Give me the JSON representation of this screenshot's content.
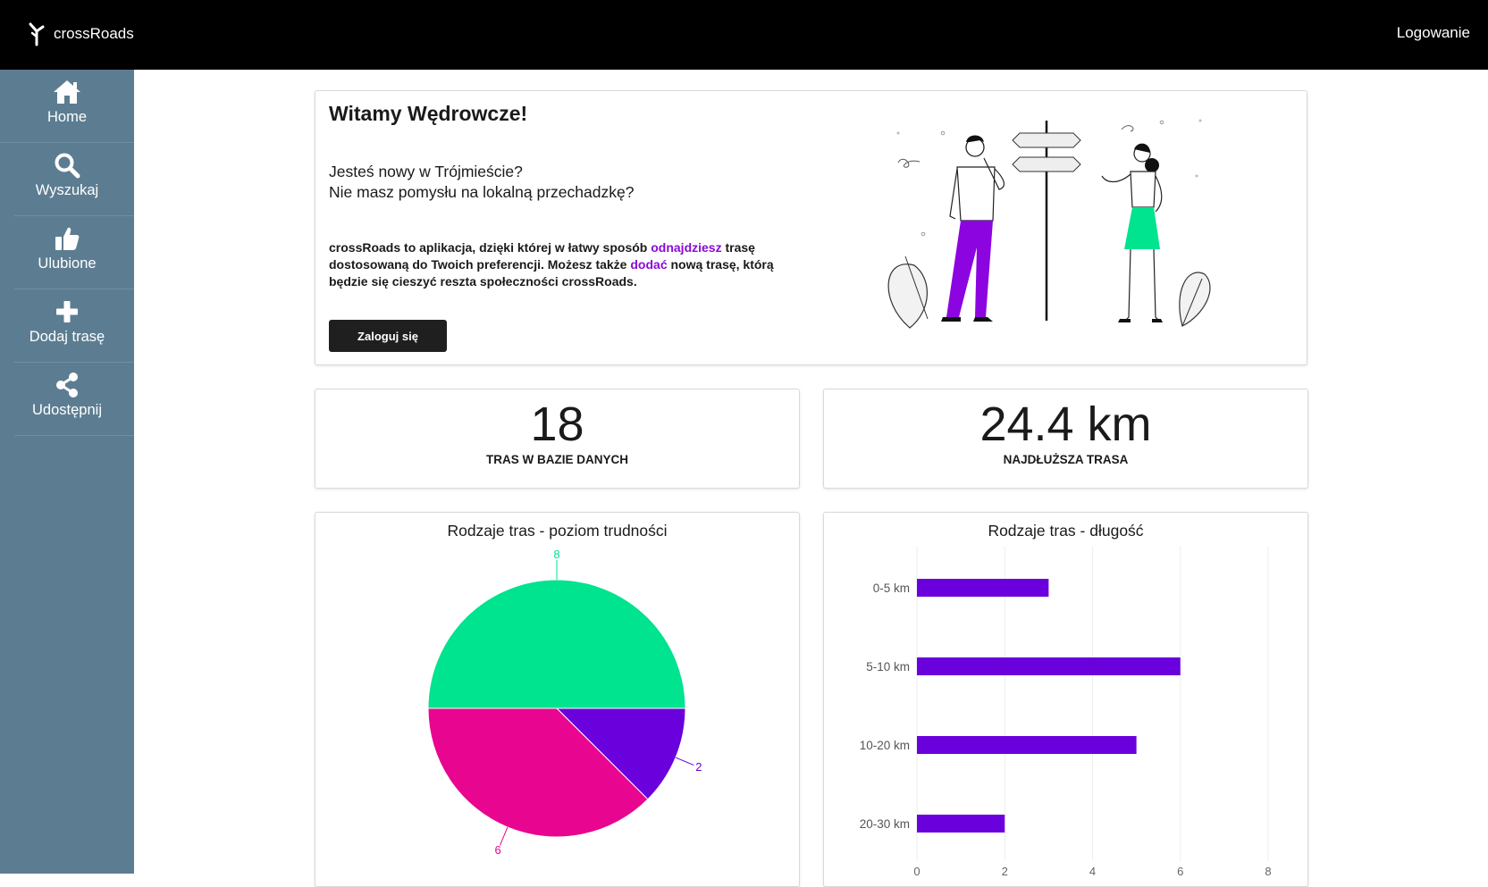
{
  "app": {
    "brand": "crossRoads",
    "login_link": "Logowanie"
  },
  "sidebar": {
    "items": [
      {
        "label": "Home",
        "icon": "home-icon"
      },
      {
        "label": "Wyszukaj",
        "icon": "search-icon"
      },
      {
        "label": "Ulubione",
        "icon": "thumbs-up-icon"
      },
      {
        "label": "Dodaj trasę",
        "icon": "plus-icon"
      },
      {
        "label": "Udostępnij",
        "icon": "share-icon"
      }
    ]
  },
  "welcome": {
    "title": "Witamy Wędrowcze!",
    "question1": "Jesteś nowy w Trójmieście?",
    "question2": "Nie masz pomysłu na lokalną przechadzkę?",
    "desc_part1": "crossRoads to aplikacja, dzięki której w łatwy sposób ",
    "desc_hl1": "odnajdziesz",
    "desc_part2": " trasę dostosowaną do Twoich preferencji. Możesz także ",
    "desc_hl2": "dodać",
    "desc_part3": " nową trasę, którą będzie się cieszyć reszta społeczności crossRoads.",
    "button": "Zaloguj się"
  },
  "stats": [
    {
      "value": "18",
      "caption": "TRAS W BAZIE DANYCH"
    },
    {
      "value": "24.4 km",
      "caption": "NAJDŁUŻSZA TRASA"
    }
  ],
  "colors": {
    "green": "#00e38f",
    "pink": "#e8058f",
    "purple": "#6a00db",
    "sidebar": "#5c7d91",
    "accent_text": "#8a0ad6"
  },
  "chart_data": [
    {
      "type": "pie",
      "title": "Rodzaje tras - poziom trudności",
      "values": [
        8,
        2,
        6
      ],
      "colors": [
        "#00e38f",
        "#6a00db",
        "#e8058f"
      ],
      "data_labels": [
        "8",
        "2",
        "6"
      ]
    },
    {
      "type": "bar",
      "orientation": "horizontal",
      "title": "Rodzaje tras - długość",
      "categories": [
        "0-5 km",
        "5-10 km",
        "10-20 km",
        "20-30 km"
      ],
      "values": [
        3,
        6,
        5,
        2
      ],
      "x_ticks": [
        "0",
        "2",
        "4",
        "6",
        "8"
      ],
      "xlim": [
        0,
        8
      ],
      "color": "#6a00db",
      "grid": true
    }
  ]
}
